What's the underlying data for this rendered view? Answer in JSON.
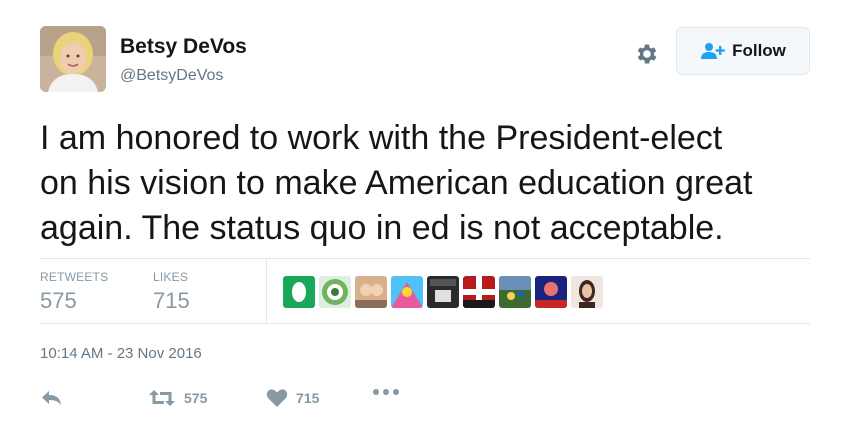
{
  "user": {
    "name": "Betsy DeVos",
    "handle": "@BetsyDeVos"
  },
  "follow_label": "Follow",
  "tweet": {
    "text": "I am honored to work with the President-elect\non his vision to make American education great\nagain. The status quo in ed is not acceptable."
  },
  "stats": {
    "retweets_label": "RETWEETS",
    "retweets_value": "575",
    "likes_label": "LIKES",
    "likes_value": "715"
  },
  "timestamp": "10:14 AM - 23 Nov 2016",
  "actions": {
    "retweet_count": "575",
    "like_count": "715"
  },
  "likers": [
    {
      "name": "liker-1",
      "bg": "#19a85a"
    },
    {
      "name": "liker-2",
      "bg": "#6fb55e"
    },
    {
      "name": "liker-3",
      "bg": "#d9b08c"
    },
    {
      "name": "liker-4",
      "bg": "#e85a9a"
    },
    {
      "name": "liker-5",
      "bg": "#2b2b2b"
    },
    {
      "name": "liker-6",
      "bg": "#b71c1c"
    },
    {
      "name": "liker-7",
      "bg": "#3d6b2f"
    },
    {
      "name": "liker-8",
      "bg": "#1a237e"
    },
    {
      "name": "liker-9",
      "bg": "#efe6e0"
    }
  ],
  "colors": {
    "text": "#14171a",
    "muted": "#657786",
    "action": "#8899a6",
    "follow_accent": "#1da1f2",
    "border": "#e1e8ed"
  },
  "icons": {
    "settings": "gear-icon",
    "follow": "add-user-icon",
    "reply": "reply-icon",
    "retweet": "retweet-icon",
    "like": "heart-icon",
    "more": "more-icon"
  }
}
